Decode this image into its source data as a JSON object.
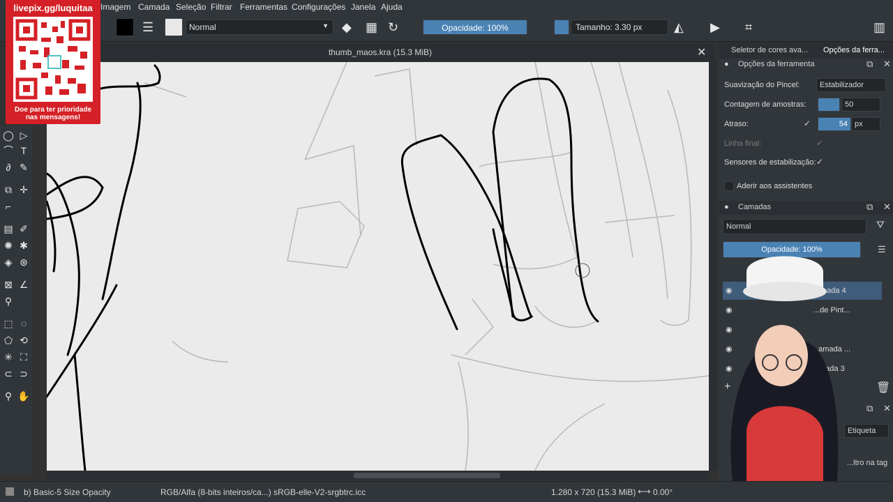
{
  "menu": {
    "items": [
      "Imagem",
      "Camada",
      "Seleção",
      "Filtrar",
      "Ferramentas",
      "Configurações",
      "Janela",
      "Ajuda"
    ]
  },
  "toolbar": {
    "blend_mode": "Normal",
    "opacity": "Opacidade: 100%",
    "size": "Tamanho: 3.30 px"
  },
  "document": {
    "title": "thumb_maos.kra (15.3 MiB)"
  },
  "dock": {
    "tab_color": "Seletor de cores ava...",
    "tab_tool": "Opções da ferra...",
    "tool_options_title": "Opções da ferramenta",
    "smoothing_label": "Suavização do Pincel:",
    "smoothing_value": "Estabilizador",
    "samples_label": "Contagem de amostras:",
    "samples_value": "50",
    "delay_label": "Atraso:",
    "delay_value": "54",
    "delay_unit": "px",
    "finish_label": "Linha final:",
    "sensors_label": "Sensores de estabilização:",
    "snap_label": "Aderir aos assistentes",
    "layers_title": "Camadas",
    "layers_blend": "Normal",
    "layers_opacity": "Opacidade:  100%",
    "layers": [
      {
        "name": "...ada 4"
      },
      {
        "name": "...de Pint..."
      },
      {
        "name": "...amada ..."
      },
      {
        "name": "...ada 3"
      }
    ],
    "tag_label": "Etiqueta",
    "filter_tag": "...ltro na tag"
  },
  "status": {
    "brush": "b) Basic-5 Size Opacity",
    "color_space": "RGB/Alfa (8-bits inteiros/ca...)  sRGB-elle-V2-srgbtrc.icc",
    "dimensions": "1.280 x 720 (15.3 MiB)",
    "rotation": "0.00°"
  },
  "overlay": {
    "url": "livepix.gg/luquitaa",
    "message": "Doe para ter prioridade nas mensagens!"
  },
  "colors": {
    "accent": "#4a82b4",
    "panel": "#31363b",
    "canvas": "#ebebeb",
    "overlay_red": "#d42026"
  }
}
